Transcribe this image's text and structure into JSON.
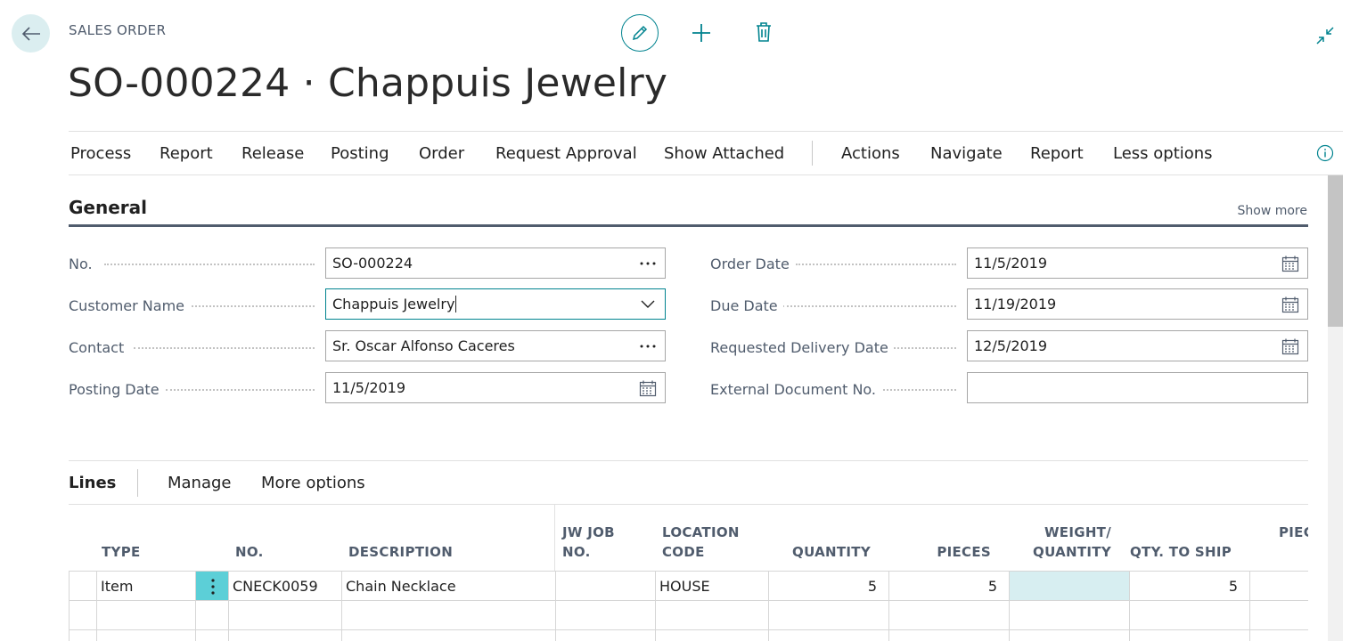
{
  "header": {
    "caption": "SALES ORDER",
    "title": "SO-000224 · Chappuis Jewelry"
  },
  "icons": {
    "back": "arrow-left-icon",
    "edit": "pencil-icon",
    "new": "plus-icon",
    "delete": "trash-icon",
    "collapse": "collapse-arrows-icon",
    "info": "info-icon",
    "accent": "#00838f"
  },
  "action_bar": {
    "items": [
      "Process",
      "Report",
      "Release",
      "Posting",
      "Order",
      "Request Approval",
      "Show Attached"
    ],
    "secondary": [
      "Actions",
      "Navigate",
      "Report",
      "Less options"
    ]
  },
  "general": {
    "title": "General",
    "show_more": "Show more",
    "left_fields": [
      {
        "label": "No.",
        "value": "SO-000224",
        "button": "ellipsis"
      },
      {
        "label": "Customer Name",
        "value": "Chappuis Jewelry",
        "button": "dropdown"
      },
      {
        "label": "Contact",
        "value": "Sr. Oscar Alfonso Caceres",
        "button": "ellipsis"
      },
      {
        "label": "Posting Date",
        "value": "11/5/2019",
        "button": "calendar"
      }
    ],
    "right_fields": [
      {
        "label": "Order Date",
        "value": "11/5/2019",
        "button": "calendar"
      },
      {
        "label": "Due Date",
        "value": "11/19/2019",
        "button": "calendar"
      },
      {
        "label": "Requested Delivery Date",
        "value": "12/5/2019",
        "button": "calendar"
      },
      {
        "label": "External Document No.",
        "value": "",
        "button": ""
      }
    ]
  },
  "lines": {
    "title": "Lines",
    "actions": [
      "Manage",
      "More options"
    ],
    "columns": {
      "type": "TYPE",
      "no": "NO.",
      "description": "DESCRIPTION",
      "jw_job_1": "JW JOB",
      "jw_job_2": "NO.",
      "location_1": "LOCATION",
      "location_2": "CODE",
      "quantity": "QUANTITY",
      "pieces": "PIECES",
      "weight_1": "WEIGHT/",
      "weight_2": "QUANTITY",
      "qty_to_ship": "QTY. TO SHIP",
      "pieces_partial": "PIEC"
    },
    "rows": [
      {
        "type": "Item",
        "no": "CNECK0059",
        "description": "Chain Necklace",
        "jw_job_no": "",
        "location_code": "HOUSE",
        "quantity": "5",
        "pieces": "5",
        "weight_quantity": "",
        "qty_to_ship": "5"
      }
    ]
  }
}
